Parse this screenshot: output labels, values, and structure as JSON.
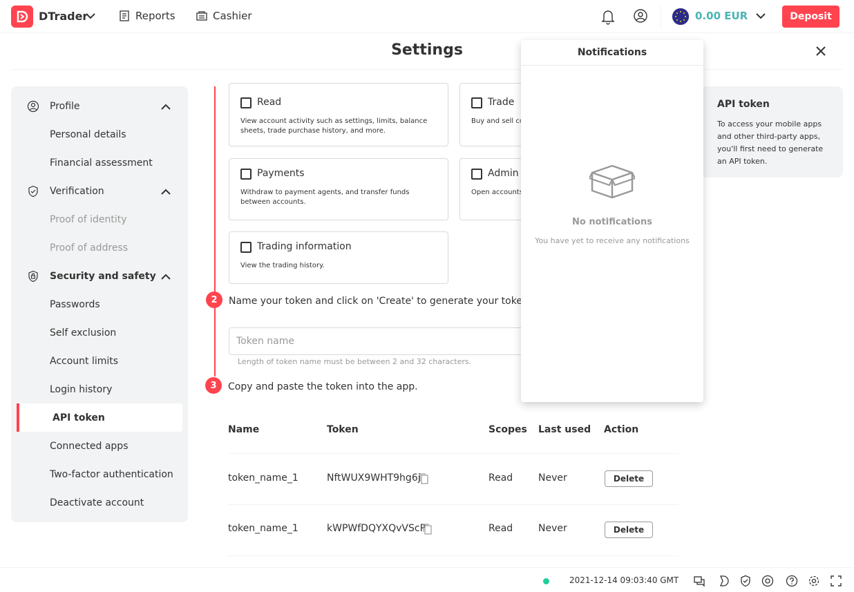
{
  "header": {
    "brand": "DTrader",
    "nav": [
      {
        "label": "Reports"
      },
      {
        "label": "Cashier"
      }
    ],
    "balance": "0.00 EUR",
    "deposit_label": "Deposit"
  },
  "settings": {
    "title": "Settings"
  },
  "sidebar": {
    "groups": [
      {
        "label": "Profile",
        "items": [
          "Personal details",
          "Financial assessment"
        ]
      },
      {
        "label": "Verification",
        "items": [
          "Proof of identity",
          "Proof of address"
        ]
      },
      {
        "label": "Security and safety",
        "items": [
          "Passwords",
          "Self exclusion",
          "Account limits",
          "Login history",
          "API token",
          "Connected apps",
          "Two-factor authentication",
          "Deactivate account"
        ]
      }
    ],
    "active": "API token"
  },
  "scopes": [
    {
      "title": "Read",
      "desc": "View account activity such as settings, limits, balance sheets, trade purchase history, and more."
    },
    {
      "title": "Trade",
      "desc": "Buy and sell con demo accounts."
    },
    {
      "title": "Payments",
      "desc": "Withdraw to payment agents, and transfer funds between accounts."
    },
    {
      "title": "Admin",
      "desc": "Open accounts, more."
    },
    {
      "title": "Trading information",
      "desc": "View the trading history."
    }
  ],
  "steps": {
    "step2_num": "2",
    "step2_text": "Name your token and click on 'Create' to generate your token.",
    "step3_num": "3",
    "step3_text": "Copy and paste the token into the app."
  },
  "token_input": {
    "placeholder": "Token name",
    "hint": "Length of token name must be between 2 and 32 characters."
  },
  "table": {
    "headers": [
      "Name",
      "Token",
      "Scopes",
      "Last used",
      "Action"
    ],
    "rows": [
      {
        "name": "token_name_1",
        "token": "NftWUX9WHT9hg6j",
        "scopes": "Read",
        "last_used": "Never",
        "action": "Delete"
      },
      {
        "name": "token_name_1",
        "token": "kWPWfDQYXQvVScP",
        "scopes": "Read",
        "last_used": "Never",
        "action": "Delete"
      }
    ]
  },
  "info_card": {
    "title": "API token",
    "text": "To access your mobile apps and other third-party apps, you'll first need to generate an API token."
  },
  "notifications": {
    "title": "Notifications",
    "empty_title": "No notifications",
    "empty_text": "You have yet to receive any notifications"
  },
  "footer": {
    "time": "2021-12-14 09:03:40 GMT"
  },
  "colors": {
    "brand": "#ff444f",
    "balance": "#4bb4b3",
    "online": "#21ce99"
  }
}
